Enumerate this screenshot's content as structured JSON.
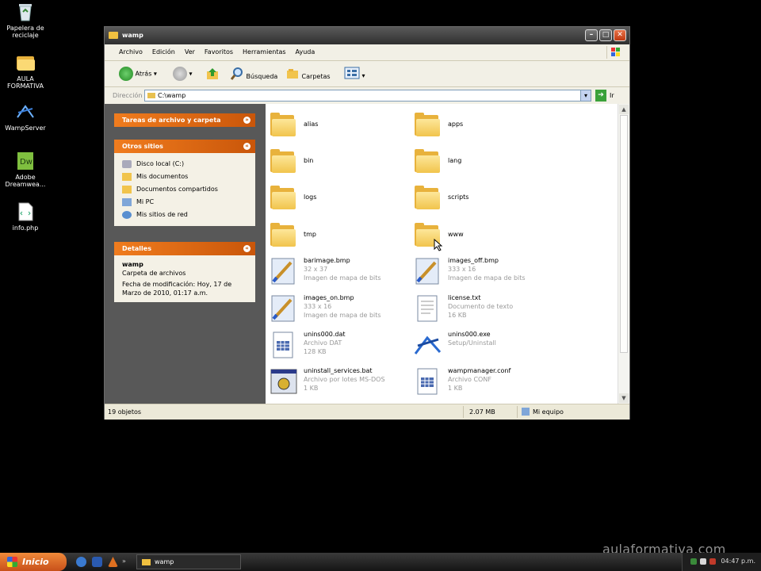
{
  "desktop": {
    "icons": [
      {
        "label": "Papelera de reciclaje",
        "icon": "recycle-bin-icon"
      },
      {
        "label": "AULA FORMATIVA",
        "icon": "folder-icon"
      },
      {
        "label": "WampServer",
        "icon": "wampserver-icon"
      },
      {
        "label": "Adobe Dreamwea...",
        "icon": "dreamweaver-icon"
      },
      {
        "label": "info.php",
        "icon": "php-file-icon"
      }
    ]
  },
  "window": {
    "title": "wamp",
    "menu": [
      "Archivo",
      "Edición",
      "Ver",
      "Favoritos",
      "Herramientas",
      "Ayuda"
    ],
    "toolbar": {
      "back": "Atrás",
      "search": "Búsqueda",
      "folders": "Carpetas"
    },
    "address": {
      "label": "Dirección",
      "value": "C:\\wamp",
      "go": "Ir"
    },
    "tasks_panel": {
      "title": "Tareas de archivo y carpeta"
    },
    "places_panel": {
      "title": "Otros sitios",
      "items": [
        "Disco local (C:)",
        "Mis documentos",
        "Documentos compartidos",
        "Mi PC",
        "Mis sitios de red"
      ]
    },
    "details_panel": {
      "title": "Detalles",
      "name": "wamp",
      "type": "Carpeta de archivos",
      "modified": "Fecha de modificación: Hoy, 17 de Marzo de 2010, 01:17 a.m."
    },
    "files": [
      {
        "name": "alias",
        "kind": "folder"
      },
      {
        "name": "apps",
        "kind": "folder"
      },
      {
        "name": "bin",
        "kind": "folder"
      },
      {
        "name": "lang",
        "kind": "folder"
      },
      {
        "name": "logs",
        "kind": "folder"
      },
      {
        "name": "scripts",
        "kind": "folder"
      },
      {
        "name": "tmp",
        "kind": "folder"
      },
      {
        "name": "www",
        "kind": "folder"
      },
      {
        "name": "barimage.bmp",
        "line2": "32 x 37",
        "line3": "Imagen de mapa de bits",
        "kind": "bmp"
      },
      {
        "name": "images_off.bmp",
        "line2": "333 x 16",
        "line3": "Imagen de mapa de bits",
        "kind": "bmp"
      },
      {
        "name": "images_on.bmp",
        "line2": "333 x 16",
        "line3": "Imagen de mapa de bits",
        "kind": "bmp"
      },
      {
        "name": "license.txt",
        "line2": "Documento de texto",
        "line3": "16 KB",
        "kind": "txt"
      },
      {
        "name": "unins000.dat",
        "line2": "Archivo DAT",
        "line3": "128 KB",
        "kind": "dat"
      },
      {
        "name": "unins000.exe",
        "line2": "Setup/Uninstall",
        "line3": "",
        "kind": "exe"
      },
      {
        "name": "uninstall_services.bat",
        "line2": "Archivo por lotes MS-DOS",
        "line3": "1 KB",
        "kind": "bat"
      },
      {
        "name": "wampmanager.conf",
        "line2": "Archivo CONF",
        "line3": "1 KB",
        "kind": "conf"
      }
    ],
    "status": {
      "count": "19 objetos",
      "size": "2.07 MB",
      "location": "Mi equipo"
    }
  },
  "taskbar": {
    "start": "Inicio",
    "task": "wamp",
    "clock": "04:47 p.m."
  },
  "watermark": "aulaformativa.com",
  "colors": {
    "panel_header": "#e06a16",
    "titlebar": "#3c3c3c",
    "folder": "#f1c44c"
  }
}
